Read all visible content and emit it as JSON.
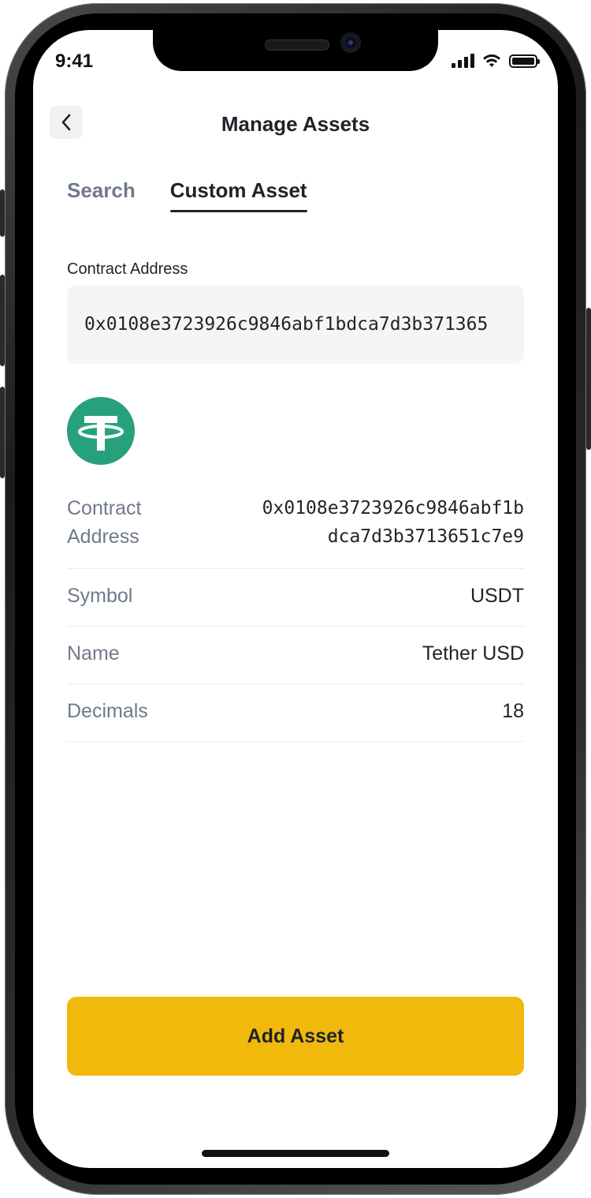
{
  "status_bar": {
    "time": "9:41"
  },
  "header": {
    "title": "Manage Assets"
  },
  "tabs": [
    {
      "label": "Search",
      "active": false
    },
    {
      "label": "Custom Asset",
      "active": true
    }
  ],
  "contract_field": {
    "label": "Contract Address",
    "value": "0x0108e3723926c9846abf1bdca7d3b371365"
  },
  "token": {
    "icon": "tether-icon",
    "brand_color": "#26a17b"
  },
  "details": {
    "contract_label": "Contract Address",
    "contract_line1": "0x0108e3723926c9846abf1b",
    "contract_line2": "dca7d3b3713651c7e9",
    "symbol_label": "Symbol",
    "symbol_value": "USDT",
    "name_label": "Name",
    "name_value": "Tether USD",
    "decimals_label": "Decimals",
    "decimals_value": "18"
  },
  "actions": {
    "add_label": "Add Asset"
  },
  "colors": {
    "accent": "#f0b90b",
    "text_primary": "#1e2329",
    "text_secondary": "#707a8a"
  }
}
